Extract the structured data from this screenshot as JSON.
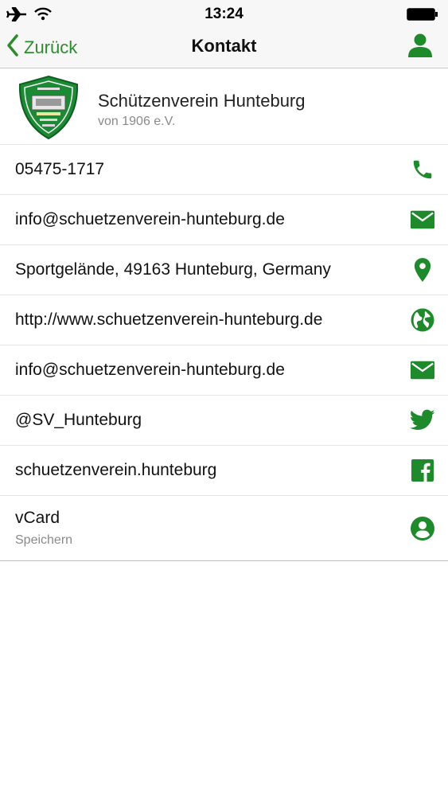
{
  "status_bar": {
    "time": "13:24"
  },
  "nav": {
    "back_label": "Zurück",
    "title": "Kontakt"
  },
  "organization": {
    "name": "Schützenverein Hunteburg",
    "subtitle": "von 1906 e.V."
  },
  "contacts": [
    {
      "text": "05475-1717",
      "icon": "phone-icon"
    },
    {
      "text": "info@schuetzenverein-hunteburg.de",
      "icon": "mail-icon"
    },
    {
      "text": "Sportgelände, 49163 Hunteburg, Germany",
      "icon": "location-pin-icon"
    },
    {
      "text": "http://www.schuetzenverein-hunteburg.de",
      "icon": "globe-icon"
    },
    {
      "text": "info@schuetzenverein-hunteburg.de",
      "icon": "mail-icon"
    },
    {
      "text": "@SV_Hunteburg",
      "icon": "twitter-icon"
    },
    {
      "text": "schuetzenverein.hunteburg",
      "icon": "facebook-icon"
    }
  ],
  "vcard": {
    "title": "vCard",
    "subtitle": "Speichern",
    "icon": "account-circle-icon"
  },
  "colors": {
    "accent": "#1f8a2c",
    "separator": "#e6e6e6",
    "bar_background": "#f7f7f7"
  }
}
